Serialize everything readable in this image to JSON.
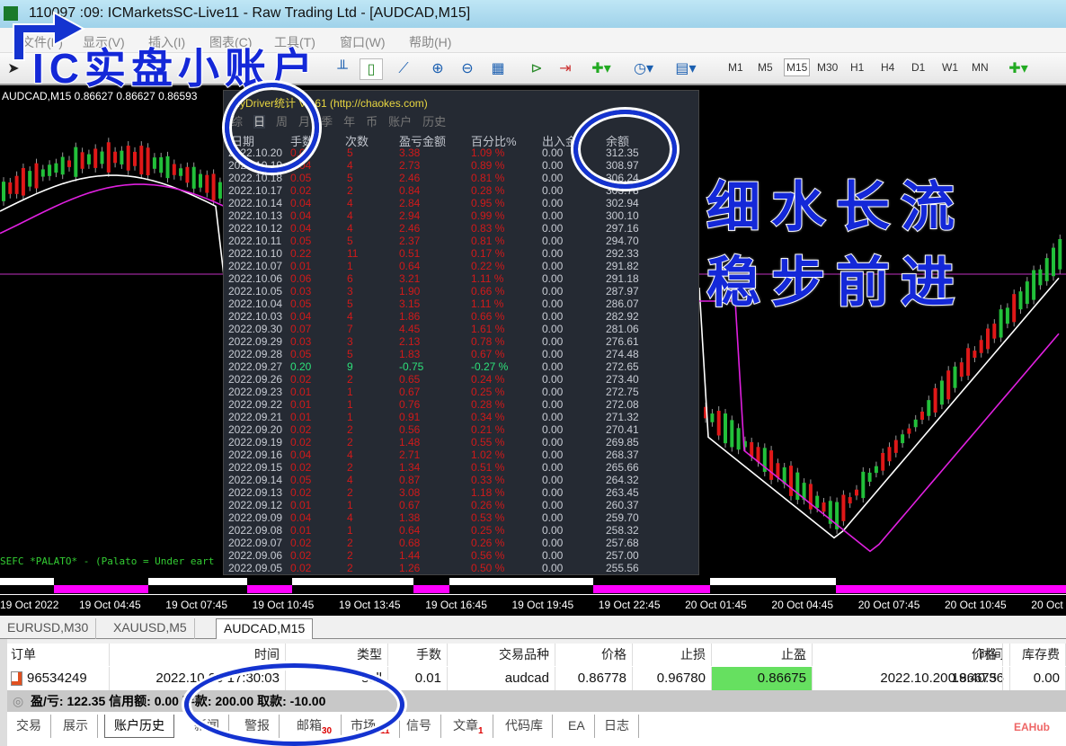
{
  "window": {
    "title": "110097  :09: ICMarketsSC-Live11 - Raw Trading Ltd - [AUDCAD,M15]"
  },
  "menu": [
    "文件(F)",
    "显示(V)",
    "插入(I)",
    "图表(C)",
    "工具(T)",
    "窗口(W)",
    "帮助(H)"
  ],
  "timeframes": [
    "M1",
    "M5",
    "M15",
    "M30",
    "H1",
    "H4",
    "D1",
    "W1",
    "MN"
  ],
  "active_timeframe": "M15",
  "chart": {
    "header": "AUDCAD,M15  0.86627 0.86627 0.86593",
    "ticker": "SEFC *PALATO* - (Palato = Under eart",
    "time_labels": [
      "19 Oct 2022",
      "19 Oct 04:45",
      "19 Oct 07:45",
      "19 Oct 10:45",
      "19 Oct 13:45",
      "19 Oct 16:45",
      "19 Oct 19:45",
      "19 Oct 22:45",
      "20 Oct 01:45",
      "20 Oct 04:45",
      "20 Oct 07:45",
      "20 Oct 10:45",
      "20 Oct"
    ]
  },
  "panel": {
    "title": "MyDriver统计 V1.61  (http://chaokes.com)",
    "tabs": [
      "综",
      "日",
      "周",
      "月",
      "季",
      "年",
      "币",
      "账户",
      "历史"
    ],
    "active_tab": "日",
    "headers": [
      "日期",
      "手数",
      "次数",
      "盈亏金额",
      "百分比%",
      "出入金",
      "余额"
    ],
    "rows": [
      [
        "2022.10.20",
        "0.05",
        "5",
        "3.38",
        "1.09 %",
        "0.00",
        "312.35"
      ],
      [
        "2022.10.19",
        "0.04",
        "4",
        "2.73",
        "0.89 %",
        "0.00",
        "308.97"
      ],
      [
        "2022.10.18",
        "0.05",
        "5",
        "2.46",
        "0.81 %",
        "0.00",
        "306.24"
      ],
      [
        "2022.10.17",
        "0.02",
        "2",
        "0.84",
        "0.28 %",
        "0.00",
        "303.78"
      ],
      [
        "2022.10.14",
        "0.04",
        "4",
        "2.84",
        "0.95 %",
        "0.00",
        "302.94"
      ],
      [
        "2022.10.13",
        "0.04",
        "4",
        "2.94",
        "0.99 %",
        "0.00",
        "300.10"
      ],
      [
        "2022.10.12",
        "0.04",
        "4",
        "2.46",
        "0.83 %",
        "0.00",
        "297.16"
      ],
      [
        "2022.10.11",
        "0.05",
        "5",
        "2.37",
        "0.81 %",
        "0.00",
        "294.70"
      ],
      [
        "2022.10.10",
        "0.22",
        "11",
        "0.51",
        "0.17 %",
        "0.00",
        "292.33"
      ],
      [
        "2022.10.07",
        "0.01",
        "1",
        "0.64",
        "0.22 %",
        "0.00",
        "291.82"
      ],
      [
        "2022.10.06",
        "0.06",
        "6",
        "3.21",
        "1.11 %",
        "0.00",
        "291.18"
      ],
      [
        "2022.10.05",
        "0.03",
        "3",
        "1.90",
        "0.66 %",
        "0.00",
        "287.97"
      ],
      [
        "2022.10.04",
        "0.05",
        "5",
        "3.15",
        "1.11 %",
        "0.00",
        "286.07"
      ],
      [
        "2022.10.03",
        "0.04",
        "4",
        "1.86",
        "0.66 %",
        "0.00",
        "282.92"
      ],
      [
        "2022.09.30",
        "0.07",
        "7",
        "4.45",
        "1.61 %",
        "0.00",
        "281.06"
      ],
      [
        "2022.09.29",
        "0.03",
        "3",
        "2.13",
        "0.78 %",
        "0.00",
        "276.61"
      ],
      [
        "2022.09.28",
        "0.05",
        "5",
        "1.83",
        "0.67 %",
        "0.00",
        "274.48"
      ],
      [
        "2022.09.27",
        "0.20",
        "9",
        "-0.75",
        "-0.27 %",
        "0.00",
        "272.65"
      ],
      [
        "2022.09.26",
        "0.02",
        "2",
        "0.65",
        "0.24 %",
        "0.00",
        "273.40"
      ],
      [
        "2022.09.23",
        "0.01",
        "1",
        "0.67",
        "0.25 %",
        "0.00",
        "272.75"
      ],
      [
        "2022.09.22",
        "0.01",
        "1",
        "0.76",
        "0.28 %",
        "0.00",
        "272.08"
      ],
      [
        "2022.09.21",
        "0.01",
        "1",
        "0.91",
        "0.34 %",
        "0.00",
        "271.32"
      ],
      [
        "2022.09.20",
        "0.02",
        "2",
        "0.56",
        "0.21 %",
        "0.00",
        "270.41"
      ],
      [
        "2022.09.19",
        "0.02",
        "2",
        "1.48",
        "0.55 %",
        "0.00",
        "269.85"
      ],
      [
        "2022.09.16",
        "0.04",
        "4",
        "2.71",
        "1.02 %",
        "0.00",
        "268.37"
      ],
      [
        "2022.09.15",
        "0.02",
        "2",
        "1.34",
        "0.51 %",
        "0.00",
        "265.66"
      ],
      [
        "2022.09.14",
        "0.05",
        "4",
        "0.87",
        "0.33 %",
        "0.00",
        "264.32"
      ],
      [
        "2022.09.13",
        "0.02",
        "2",
        "3.08",
        "1.18 %",
        "0.00",
        "263.45"
      ],
      [
        "2022.09.12",
        "0.01",
        "1",
        "0.67",
        "0.26 %",
        "0.00",
        "260.37"
      ],
      [
        "2022.09.09",
        "0.04",
        "4",
        "1.38",
        "0.53 %",
        "0.00",
        "259.70"
      ],
      [
        "2022.09.08",
        "0.01",
        "1",
        "0.64",
        "0.25 %",
        "0.00",
        "258.32"
      ],
      [
        "2022.09.07",
        "0.02",
        "2",
        "0.68",
        "0.26 %",
        "0.00",
        "257.68"
      ],
      [
        "2022.09.06",
        "0.02",
        "2",
        "1.44",
        "0.56 %",
        "0.00",
        "257.00"
      ],
      [
        "2022.09.05",
        "0.02",
        "2",
        "1.26",
        "0.50 %",
        "0.00",
        "255.56"
      ]
    ]
  },
  "chart_tabs": [
    "EURUSD,M30",
    "XAUUSD,M5",
    "AUDCAD,M15"
  ],
  "terminal": {
    "headers": [
      "订单",
      "时间",
      "类型",
      "手数",
      "交易品种",
      "价格",
      "止损",
      "止盈",
      "时间",
      "价格",
      "库存费"
    ],
    "row": [
      "96534249",
      "2022.10.20 17:30:03",
      "sell",
      "0.01",
      "audcad",
      "0.86778",
      "0.96780",
      "0.86675",
      "2022.10.20 19:40:36",
      "0.86675",
      "0.00"
    ],
    "summary": "盈/亏: 122.35  信用额: 0.00  存款: 200.00  取款: -10.00",
    "tabs": [
      {
        "label": "交易"
      },
      {
        "label": "展示"
      },
      {
        "label": "账户历史"
      },
      {
        "label": "新闻"
      },
      {
        "label": "警报"
      },
      {
        "label": "邮箱",
        "badge": "30"
      },
      {
        "label": "市场",
        "badge": "111"
      },
      {
        "label": "信号"
      },
      {
        "label": "文章",
        "badge": "1"
      },
      {
        "label": "代码库"
      },
      {
        "label": "EA"
      },
      {
        "label": "日志"
      }
    ]
  },
  "overlay": {
    "title": "IC实盘小账户",
    "slogan1": "细水长流",
    "slogan2": "稳步前进",
    "watermark": "EAHub"
  },
  "colors": {
    "up": "#22c03a",
    "down": "#e01818",
    "ma_fast": "#ffffff",
    "ma_slow": "#e020e0",
    "tp_highlight": "#66e060"
  }
}
